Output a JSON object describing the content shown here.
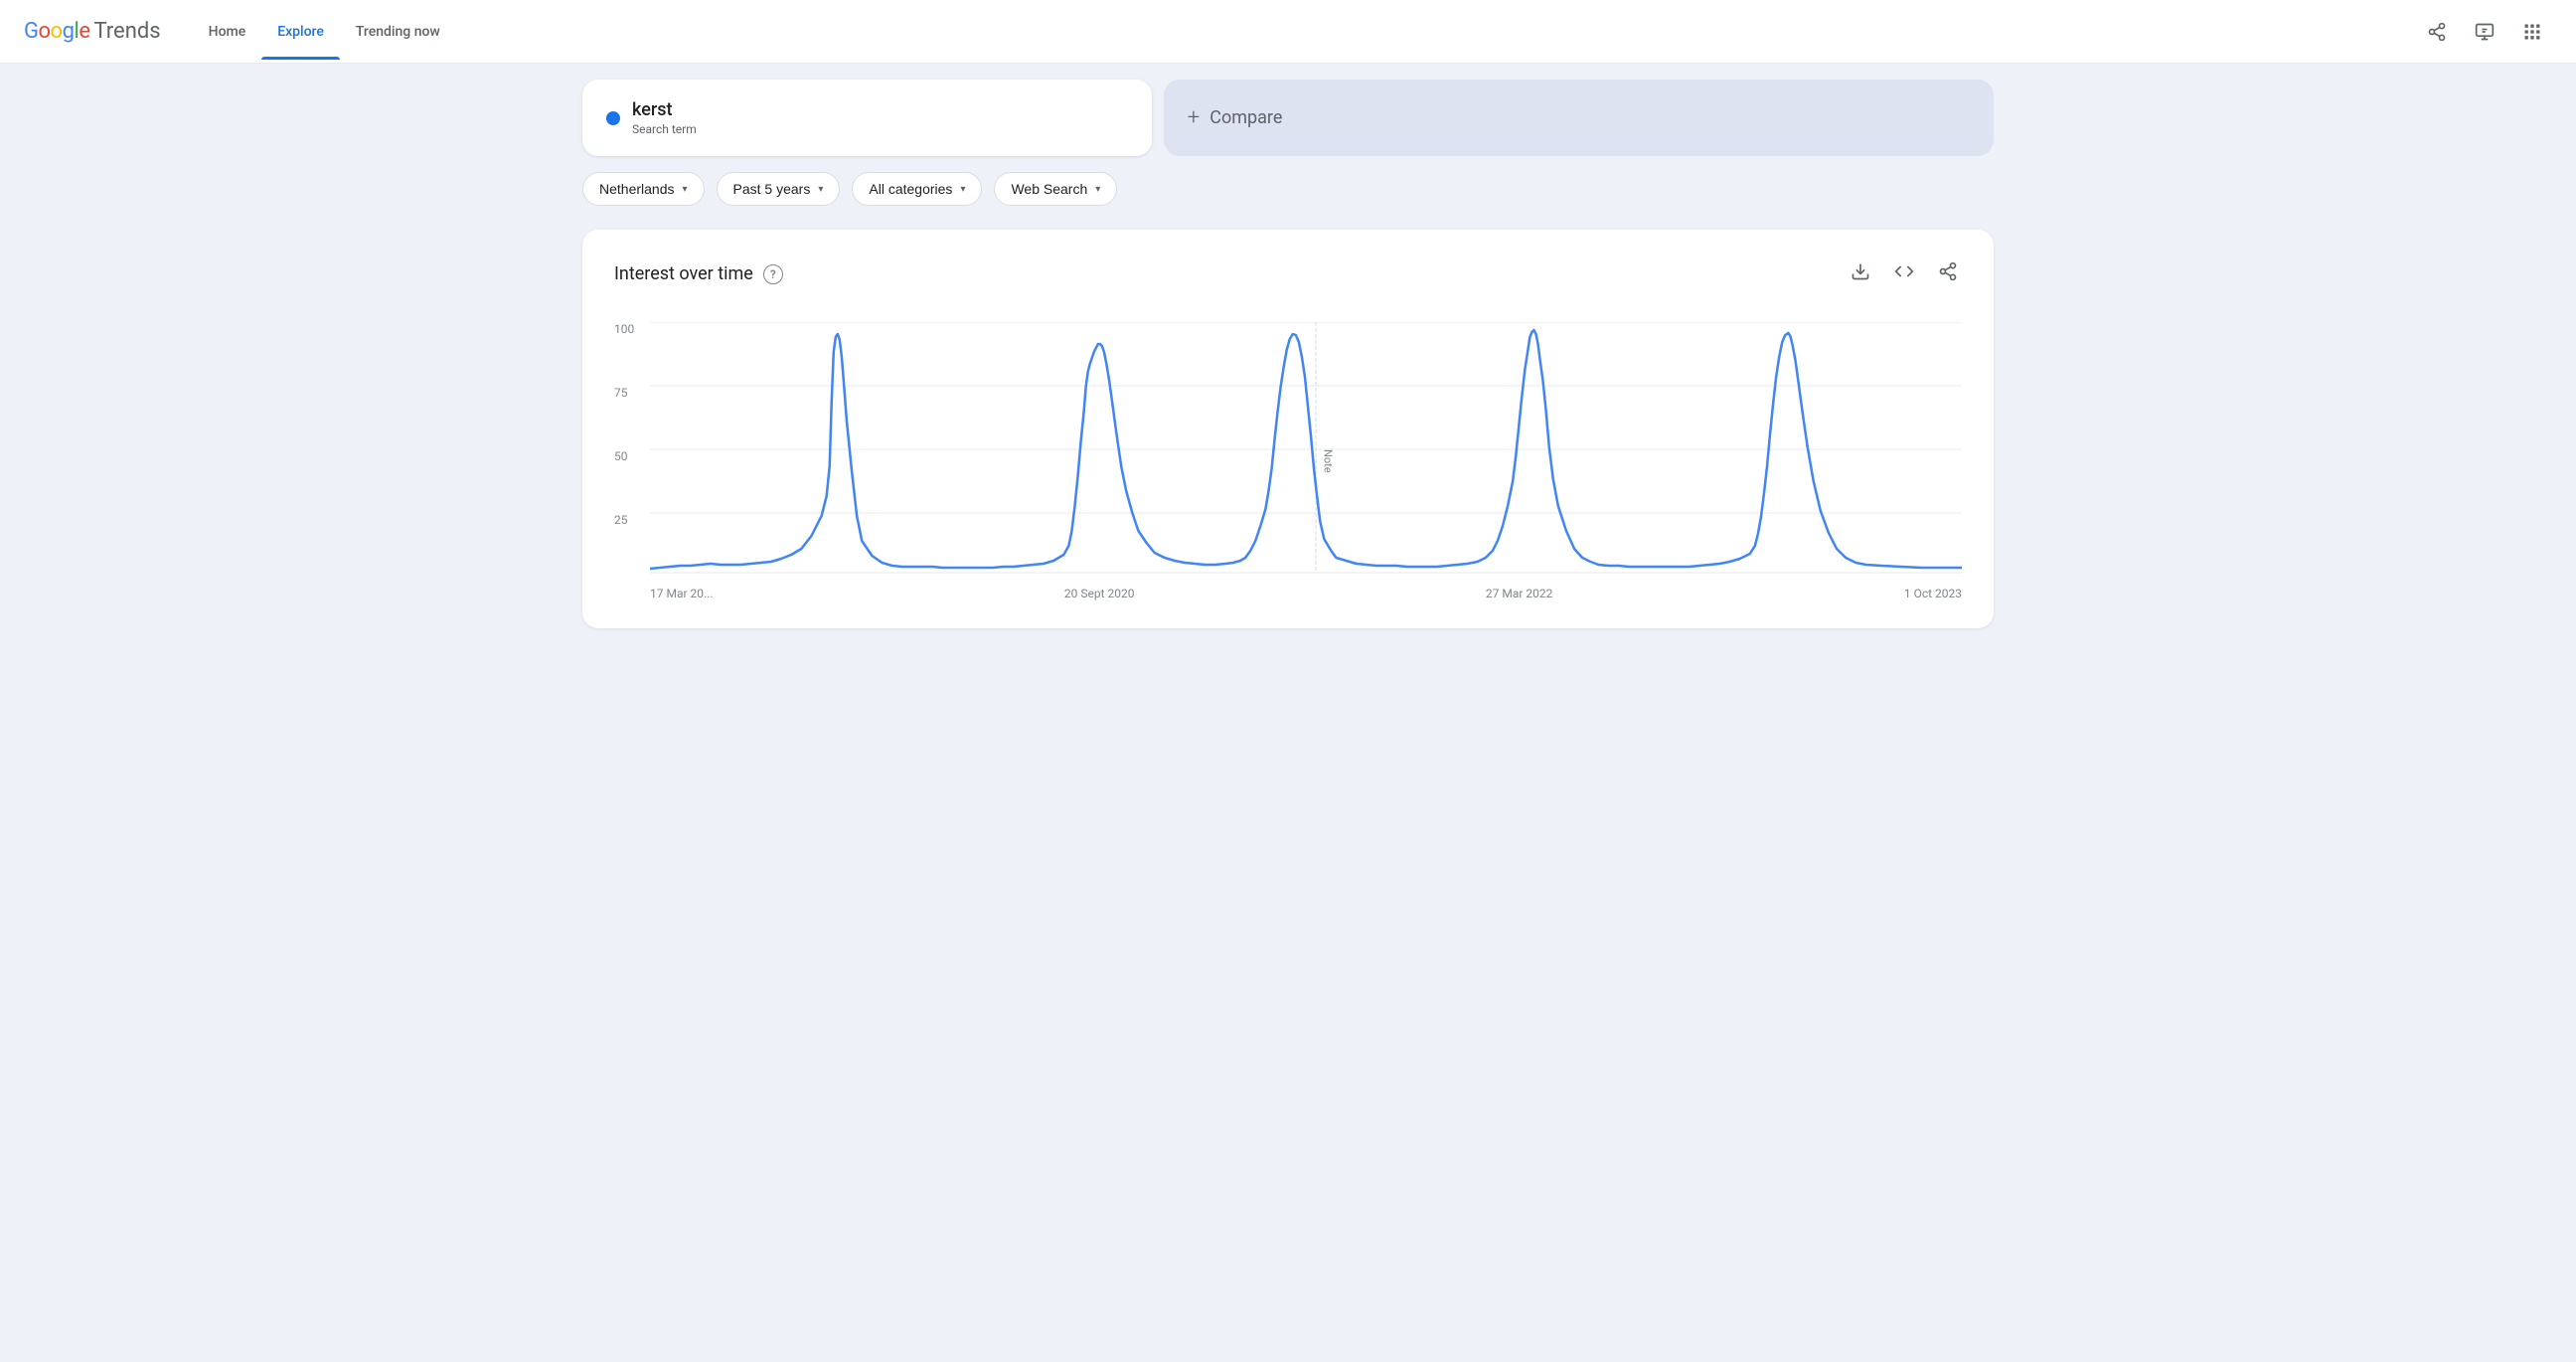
{
  "header": {
    "logo_google": "Google",
    "logo_trends": "Trends",
    "nav_items": [
      {
        "label": "Home",
        "active": false
      },
      {
        "label": "Explore",
        "active": true
      },
      {
        "label": "Trending now",
        "active": false
      }
    ],
    "share_icon": "share",
    "feedback_icon": "feedback",
    "apps_icon": "apps"
  },
  "search": {
    "term": "kerst",
    "type": "Search term",
    "dot_color": "#1a73e8"
  },
  "compare": {
    "label": "Compare",
    "plus": "+"
  },
  "filters": [
    {
      "label": "Netherlands",
      "value": "netherlands"
    },
    {
      "label": "Past 5 years",
      "value": "past_5_years"
    },
    {
      "label": "All categories",
      "value": "all_categories"
    },
    {
      "label": "Web Search",
      "value": "web_search"
    }
  ],
  "chart": {
    "title": "Interest over time",
    "y_labels": [
      "100",
      "75",
      "50",
      "25",
      ""
    ],
    "x_labels": [
      "17 Mar 20...",
      "20 Sept 2020",
      "27 Mar 2022",
      "1 Oct 2023"
    ],
    "note_label": "Note",
    "download_icon": "download",
    "embed_icon": "embed",
    "share_icon": "share"
  }
}
